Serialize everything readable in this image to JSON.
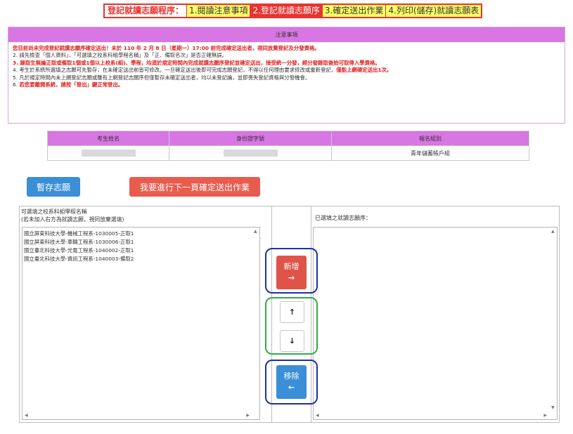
{
  "steps": {
    "lead": "登記就讀志願程序：",
    "step1": "1.閱讀注意事項",
    "step2": "2.登記就讀志願序",
    "step3": "3.確定送出作業",
    "step4": "4.列印(儲存)就讀志願表"
  },
  "notice": {
    "title": "注意事項",
    "item1": {
      "prefix": "1. ",
      "a": "您目前尚未完成登記就讀志願序確定送出！未於 110 年 2 月 8 日（星期一）17:00 前完成確定送出者，視同放棄登記及分發資格。"
    },
    "item2": "2. 請先檢查「個人資料」、「可選填之校系科組學程名稱」及「正、備取名次」是否正確無誤。",
    "item3": "3. 錄取生無論正取或備取1個或1個以上校系(組)、學程，均須於規定時間內完成就讀志願序登記並確定送出，接受統一分發，經分發錄取後始可取得入學資格。",
    "item4": {
      "a": "4. 考生於系統所選填之志願可先暫存，在未確定送出前皆可修改。一旦確定送出後即可完成志願登記，不得以任何理由要求修改或重新登記，",
      "b": "僅能上網確定送出1次。"
    },
    "item5": "5. 凡於規定時間內未上網登記志願或雖有上網登記志願序但僅暫存未確定送出者，均以未登記論，並即喪失登記資格與分發機會。",
    "item6": {
      "a": "6. ",
      "b": "若您要離開系統，請按「登出」鍵正常登出。"
    }
  },
  "info_table": {
    "headers": [
      "考生姓名",
      "身份證字號",
      "報名組別"
    ],
    "group_value": "青年儲蓄帳戶組"
  },
  "buttons": {
    "save": "暫存志願",
    "next": "我要進行下一頁確定送出作業",
    "add_label": "新增",
    "add_icon": "→",
    "up_icon": "↑",
    "down_icon": "↓",
    "remove_label": "移除",
    "remove_icon": "←"
  },
  "left_panel": {
    "header_line1": "可選填之校系科組學程名稱",
    "header_line2": "(若未加入右方為就讀志願，視同放棄選填)",
    "items": [
      "國立屏東科技大學-機械工程系-1030005-正取1",
      "國立屏東科技大學-車輛工程系-1030006-正取1",
      "國立臺北科技大學-光電工程系-1040002-正取1",
      "國立臺北科技大學-資訊工程系-1040003-備取2"
    ]
  },
  "right_panel": {
    "header": "已選填之就讀志願序："
  },
  "colors": {
    "accent_red": "#e8332f",
    "header_purple": "#d876e3",
    "button_blue": "#3b8fd6",
    "button_red": "#de5448",
    "ring_blue": "#1a32a8",
    "ring_green": "#2dae46"
  }
}
